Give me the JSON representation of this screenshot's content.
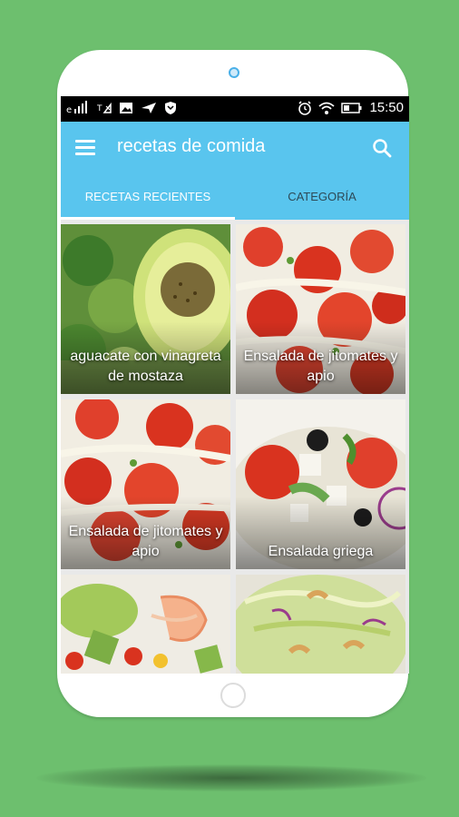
{
  "status_bar": {
    "time": "15:50",
    "left_icons": [
      "signal-icon",
      "no-signal-icon",
      "image-icon",
      "send-icon",
      "shield-icon"
    ],
    "right_icons": [
      "alarm-icon",
      "wifi-icon",
      "battery-icon"
    ]
  },
  "toolbar": {
    "title": "recetas de comida",
    "menu_icon": "hamburger-menu-icon",
    "search_icon": "search-icon"
  },
  "tabs": [
    {
      "label": "RECETAS RECIENTES",
      "selected": true
    },
    {
      "label": "CATEGORÍA",
      "selected": false
    }
  ],
  "recipes": [
    {
      "title": "aguacate con vinagreta de mostaza"
    },
    {
      "title": "Ensalada de jitomates y apio"
    },
    {
      "title": "Ensalada de jitomates y apio"
    },
    {
      "title": "Ensalada griega"
    },
    {
      "title": ""
    },
    {
      "title": ""
    }
  ],
  "colors": {
    "background": "#6dbf6e",
    "primary": "#59c5ee",
    "tab_inactive_text": "#2d4a57"
  }
}
